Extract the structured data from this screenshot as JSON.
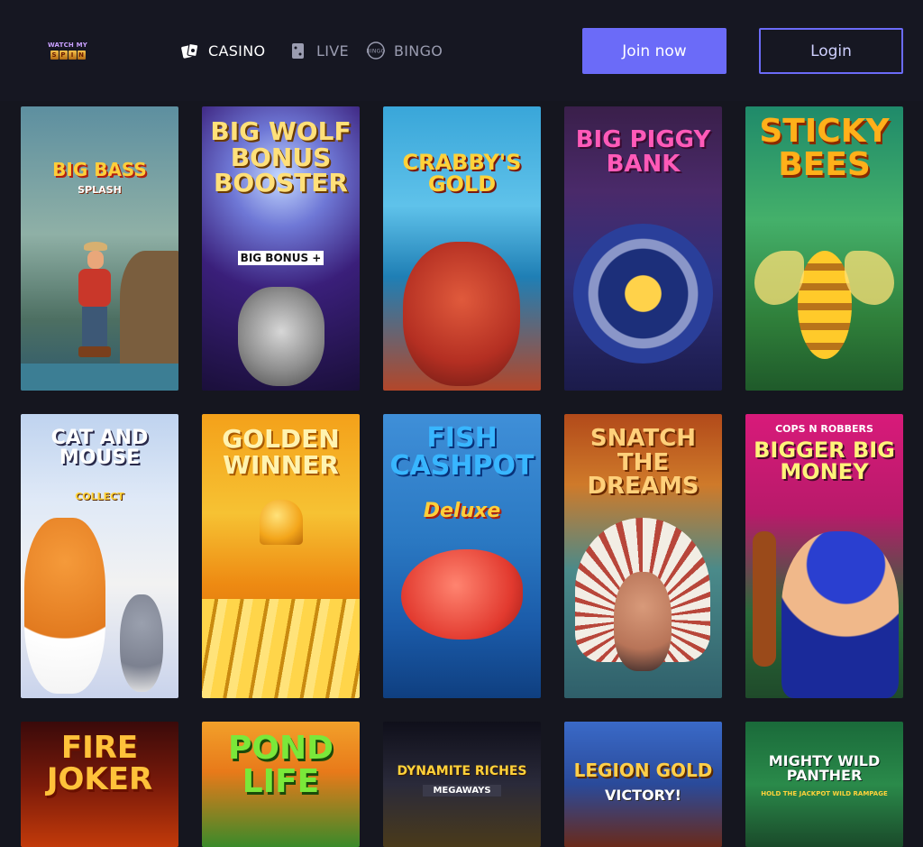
{
  "header": {
    "logo_top": "WATCH MY",
    "logo_bottom": "SPIN",
    "nav": [
      {
        "label": "CASINO",
        "icon": "cards-icon"
      },
      {
        "label": "LIVE",
        "icon": "live-cards-icon"
      },
      {
        "label": "BINGO",
        "icon": "bingo-ball-icon"
      }
    ],
    "join_label": "Join now",
    "login_label": "Login",
    "accent": "#6b6bf8"
  },
  "games": [
    {
      "title": "BIG BASS",
      "subtitle": "SPLASH"
    },
    {
      "title": "BIG WOLF BONUS BOOSTER",
      "subtitle": "BIG BONUS +"
    },
    {
      "title": "CRABBY'S GOLD",
      "subtitle": ""
    },
    {
      "title": "BIG PIGGY BANK",
      "subtitle": ""
    },
    {
      "title": "STICKY BEES",
      "subtitle": ""
    },
    {
      "title": "CAT AND MOUSE",
      "subtitle": "COLLECT"
    },
    {
      "title": "GOLDEN WINNER",
      "subtitle": ""
    },
    {
      "title": "FISH CASHPOT",
      "subtitle": "Deluxe"
    },
    {
      "title": "SNATCH THE DREAMS",
      "subtitle": ""
    },
    {
      "title": "BIGGER BIG MONEY",
      "subtitle": "COPS N ROBBERS"
    },
    {
      "title": "FIRE JOKER",
      "subtitle": ""
    },
    {
      "title": "POND LIFE",
      "subtitle": ""
    },
    {
      "title": "DYNAMITE RICHES",
      "subtitle": "MEGAWAYS"
    },
    {
      "title": "LEGION GOLD",
      "subtitle": "VICTORY!"
    },
    {
      "title": "MIGHTY WILD PANTHER",
      "subtitle": "HOLD THE JACKPOT WILD RAMPAGE"
    }
  ]
}
